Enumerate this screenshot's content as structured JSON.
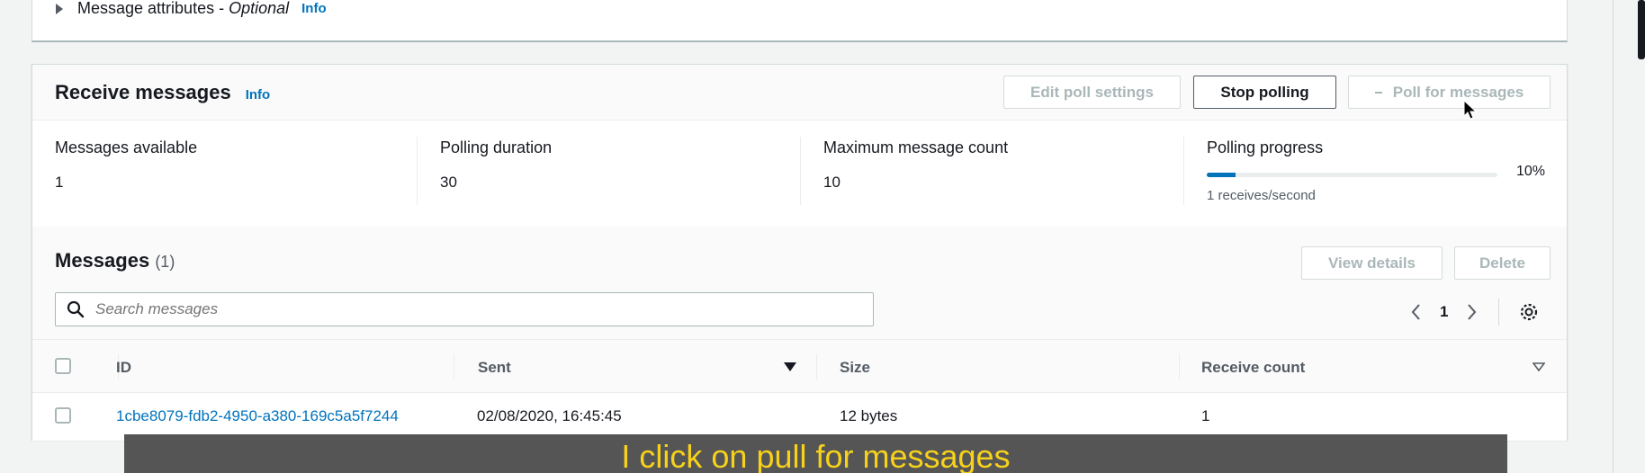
{
  "attributes": {
    "label": "Message attributes - ",
    "optional": "Optional",
    "info": "Info"
  },
  "receive": {
    "title": "Receive messages",
    "info": "Info",
    "edit_poll": "Edit poll settings",
    "stop_polling": "Stop polling",
    "poll_for_messages": "Poll for messages"
  },
  "stats": {
    "messages_available_label": "Messages available",
    "messages_available_value": "1",
    "polling_duration_label": "Polling duration",
    "polling_duration_value": "30",
    "max_count_label": "Maximum message count",
    "max_count_value": "10",
    "progress_label": "Polling progress",
    "progress_pct": "10%",
    "progress_value": 0.1,
    "progress_rate": "1 receives/second"
  },
  "messages": {
    "title": "Messages",
    "count": "(1)",
    "view_details": "View details",
    "delete": "Delete",
    "search_placeholder": "Search messages",
    "page": "1",
    "columns": [
      "ID",
      "Sent",
      "Size",
      "Receive count"
    ],
    "rows": [
      {
        "id": "1cbe8079-fdb2-4950-a380-169c5a5f7244",
        "sent": "02/08/2020, 16:45:45",
        "size": "12 bytes",
        "receive_count": "1"
      }
    ]
  },
  "caption": "I click on pull for messages",
  "colors": {
    "accent": "#0073bb",
    "caption_text": "#f6d21b"
  }
}
